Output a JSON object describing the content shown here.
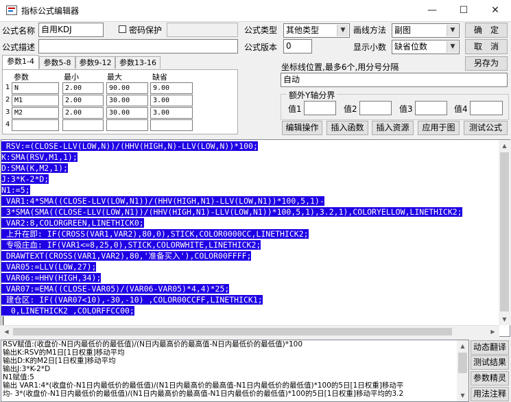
{
  "window": {
    "title": "指标公式编辑器",
    "minimize_glyph": "—",
    "maximize_glyph": "☐",
    "close_glyph": "✕"
  },
  "header": {
    "formula_name_label": "公式名称",
    "formula_name_value": "自用KDJ",
    "password_label": "密码保护",
    "password_checked": false,
    "password_value": "",
    "formula_type_label": "公式类型",
    "formula_type_value": "其他类型",
    "draw_method_label": "画线方法",
    "draw_method_value": "副图",
    "desc_label": "公式描述",
    "desc_value": "",
    "version_label": "公式版本",
    "version_value": "0",
    "decimals_label": "显示小数",
    "decimals_value": "缺省位数"
  },
  "buttons": {
    "ok": "确　定",
    "cancel": "取　消",
    "save_as": "另存为",
    "edit_ops": "编辑操作",
    "insert_func": "插入函数",
    "insert_resource": "插入资源",
    "apply_to_chart": "应用于图",
    "test_formula": "测试公式"
  },
  "tabs": [
    "参数1-4",
    "参数5-8",
    "参数9-12",
    "参数13-16"
  ],
  "params": {
    "headers": [
      "参数",
      "最小",
      "最大",
      "缺省"
    ],
    "rows": [
      {
        "num": "1",
        "name": "N",
        "min": "2.00",
        "max": "90.00",
        "default": "9.00"
      },
      {
        "num": "2",
        "name": "M1",
        "min": "2.00",
        "max": "30.00",
        "default": "3.00"
      },
      {
        "num": "3",
        "name": "M2",
        "min": "2.00",
        "max": "30.00",
        "default": "3.00"
      },
      {
        "num": "4",
        "name": "",
        "min": "",
        "max": "",
        "default": ""
      }
    ]
  },
  "axis": {
    "label": "坐标线位置,最多6个,用分号分隔",
    "value": "自动",
    "extra_group_label": "额外Y轴分界",
    "value_labels": [
      "值1",
      "值2",
      "值3",
      "值4"
    ],
    "values": [
      "",
      "",
      "",
      ""
    ]
  },
  "code": [
    " RSV:=(CLOSE-LLV(LOW,N))/(HHV(HIGH,N)-LLV(LOW,N))*100;",
    "K:SMA(RSV,M1,1);",
    "D:SMA(K,M2,1);",
    "J:3*K-2*D;",
    "N1:=5;",
    " VAR1:4*SMA((CLOSE-LLV(LOW,N1))/(HHV(HIGH,N1)-LLV(LOW,N1))*100,5,1)-",
    " 3*SMA(SMA((CLOSE-LLV(LOW,N1))/(HHV(HIGH,N1)-LLV(LOW,N1))*100,5,1),3.2,1),COLORYELLOW,LINETHICK2;",
    " VAR2:8,COLORGREEN,LINETHICK0;",
    " 上升在即: IF(CROSS(VAR1,VAR2),80,0),STICK,COLOR0000CC,LINETHICK2;",
    " 专吸庄血: IF(VAR1<=8,25,0),STICK,COLORWHITE,LINETHICK2;",
    " DRAWTEXT(CROSS(VAR1,VAR2),80,'准备买入'),COLOR00FFFF;",
    " VAR05:=LLV(LOW,27);",
    " VAR06:=HHV(HIGH,34);",
    " VAR07:=EMA((CLOSE-VAR05)/(VAR06-VAR05)*4,4)*25;",
    " 建仓区: IF((VAR07<10),-30,-10) ,COLOR00CCFF,LINETHICK1;",
    "  0,LINETHICK2 ,COLORFFCC00;"
  ],
  "output": [
    "RSV赋值:(收盘价-N日内最低价的最低值)/(N日内最高价的最高值-N日内最低价的最低值)*100",
    "输出K:RSV的M1日[1日权重]移动平均",
    "输出D:K的M2日[1日权重]移动平均",
    "输出J:3*K-2*D",
    "N1赋值:5",
    "输出 VAR1:4*(收盘价-N1日内最低价的最低值)/(N1日内最高价的最高值-N1日内最低价的最低值)*100的5日[1日权重]移动平",
    "均- 3*(收盘价-N1日内最低价的最低值)/(N1日内最高价的最高值-N1日内最低价的最低值)*100的5日[1日权重]移动平均的3.2"
  ],
  "side_buttons": [
    "动态翻译",
    "测试结果",
    "参数精灵",
    "用法注释"
  ],
  "colors": {
    "selection": "#1f00e5",
    "window_bg": "#f0f0f0"
  }
}
